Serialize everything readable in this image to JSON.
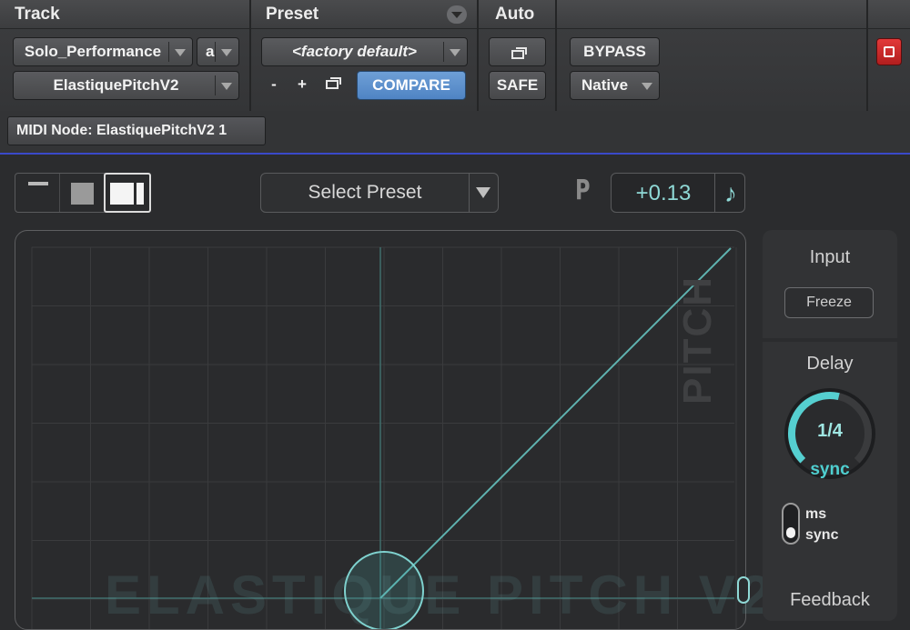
{
  "header": {
    "track_title": "Track",
    "preset_title": "Preset",
    "auto_title": "Auto",
    "track_name": "Solo_Performance",
    "channel": "a",
    "plugin_name": "ElastiquePitchV2",
    "preset_name": "<factory default>",
    "minus": "-",
    "plus": "+",
    "compare": "COMPARE",
    "safe": "SAFE",
    "bypass": "BYPASS",
    "native": "Native"
  },
  "midi_node": "MIDI Node: ElastiquePitchV2 1",
  "toolbar": {
    "select_preset": "Select Preset",
    "p_label": "P",
    "pitch_value": "+0.13",
    "note_icon": "♪"
  },
  "display": {
    "pitch_watermark": "PITCH",
    "logo_watermark": "ELASTIQUE PITCH V2"
  },
  "right_panel": {
    "input_title": "Input",
    "freeze": "Freeze",
    "delay_title": "Delay",
    "delay_value": "1/4",
    "delay_mode": "sync",
    "delay_level": 0.55,
    "toggle_ms": "ms",
    "toggle_sync": "sync",
    "feedback_title": "Feedback"
  },
  "colors": {
    "accent": "#8fd9d6",
    "compare_blue": "#5a8fcc",
    "bypass_red": "#d42a2a",
    "divider_blue": "#3a49c9"
  }
}
